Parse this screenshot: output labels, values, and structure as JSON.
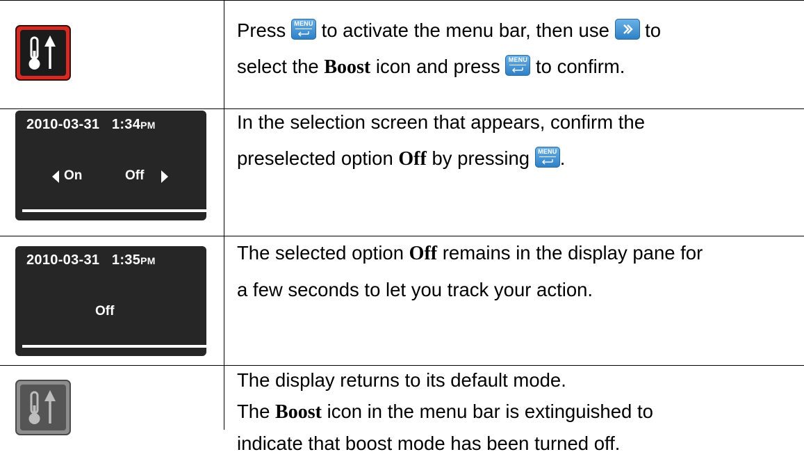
{
  "rows": [
    {
      "text_parts": [
        "Press ",
        " to activate the menu bar, then use ",
        " to",
        "select the ",
        "Boost",
        " icon and press ",
        " to confirm."
      ]
    },
    {
      "screen": {
        "date": "2010-03-31",
        "time": "1:34",
        "ampm": "PM",
        "option_on": "On",
        "option_off": "Off"
      },
      "text_parts": [
        "In the selection screen that appears, confirm the",
        "preselected option ",
        "Off",
        " by pressing ",
        "."
      ]
    },
    {
      "screen": {
        "date": "2010-03-31",
        "time": "1:35",
        "ampm": "PM",
        "option_off": "Off"
      },
      "text_parts": [
        "The selected option ",
        "Off",
        " remains in the display pane for",
        "a few seconds to let you track your action."
      ]
    },
    {
      "text_parts": [
        "The display returns to its default mode.",
        "The ",
        "Boost",
        " icon in the menu bar is extinguished to",
        "indicate that boost mode has been turned off."
      ]
    }
  ],
  "keys": {
    "menu_label": "MENU",
    "menu_icon": "enter-arrow-icon",
    "next_icon": "double-chevron-right-icon"
  },
  "colors": {
    "boost_active": "#d52b25",
    "boost_inactive": "#8d8d8d",
    "key_blue": "#3b8fd3",
    "lcd_background": "#262626"
  }
}
